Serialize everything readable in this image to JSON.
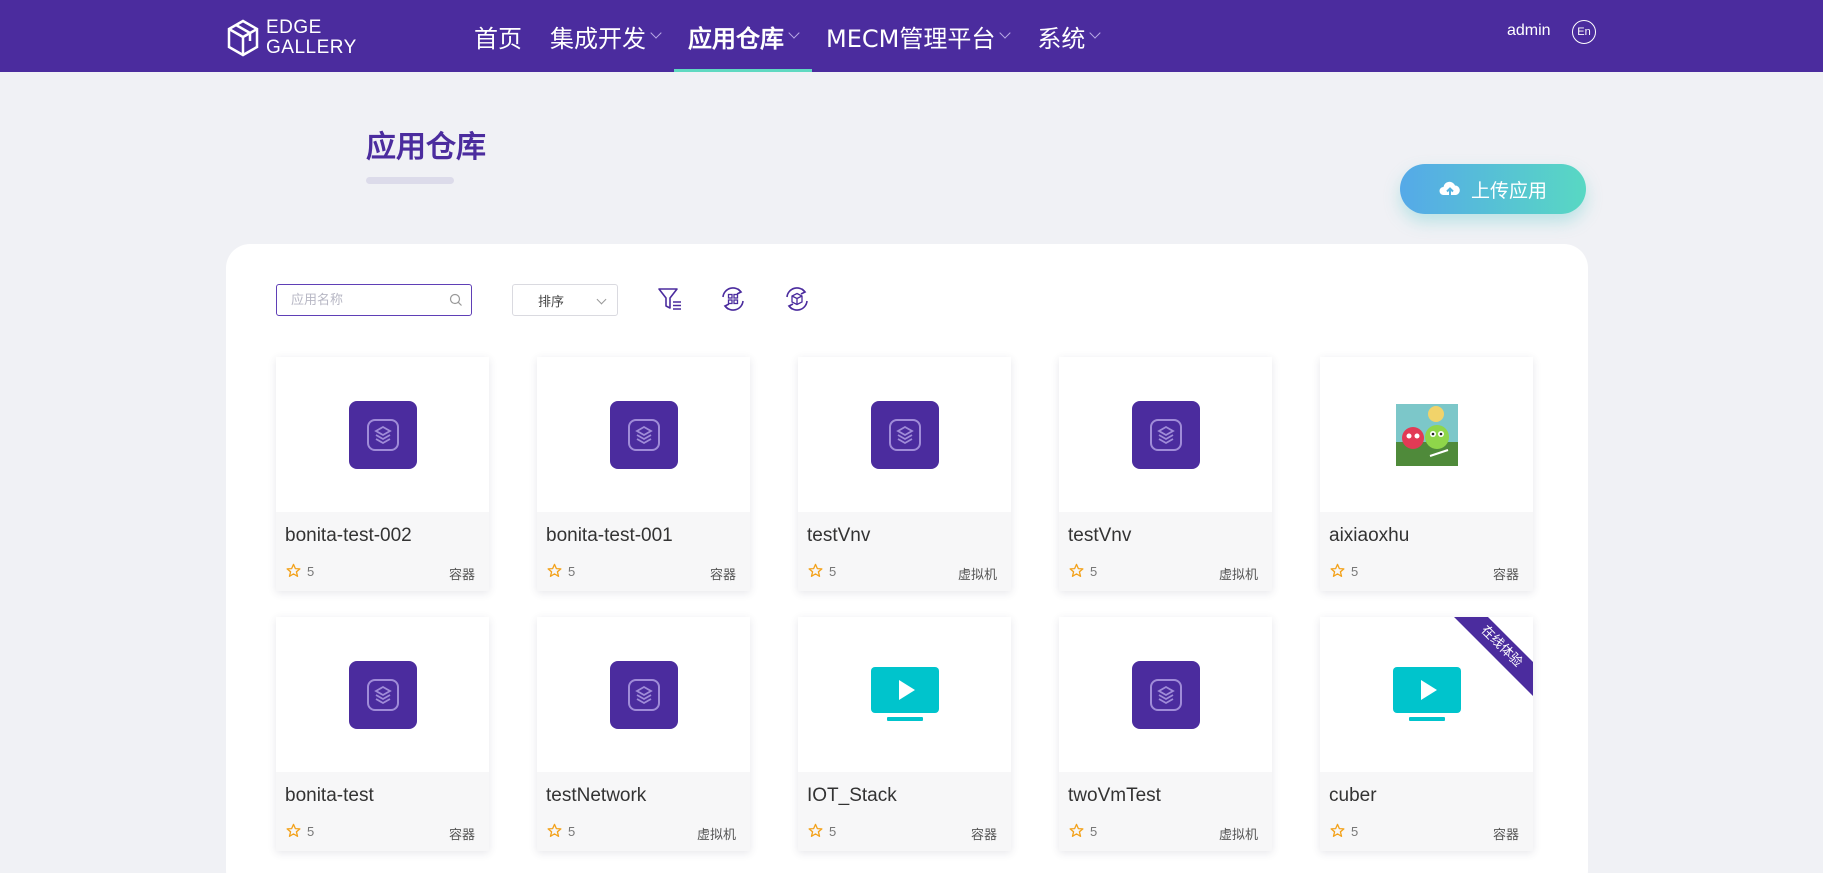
{
  "topbar": {
    "logo_line1": "EDGE",
    "logo_line2": "GALLERY",
    "nav": [
      {
        "label": "首页"
      },
      {
        "label": "集成开发"
      },
      {
        "label": "应用仓库"
      },
      {
        "label": "MECM管理平台"
      },
      {
        "label": "系统"
      }
    ],
    "user": "admin",
    "lang": "En"
  },
  "header": {
    "title": "应用仓库",
    "upload_label": "上传应用"
  },
  "toolbar": {
    "search_placeholder": "应用名称",
    "sort_label": "排序"
  },
  "apps": [
    {
      "name": "bonita-test-002",
      "score": "5",
      "type": "容器",
      "icon": "layers-icon"
    },
    {
      "name": "bonita-test-001",
      "score": "5",
      "type": "容器",
      "icon": "layers-icon"
    },
    {
      "name": "testVnv",
      "score": "5",
      "type": "虚拟机",
      "icon": "layers-icon"
    },
    {
      "name": "testVnv",
      "score": "5",
      "type": "虚拟机",
      "icon": "layers-icon"
    },
    {
      "name": "aixiaoxhu",
      "score": "5",
      "type": "容器",
      "icon": "game-thumbnail"
    },
    {
      "name": "bonita-test",
      "score": "5",
      "type": "容器",
      "icon": "layers-icon"
    },
    {
      "name": "testNetwork",
      "score": "5",
      "type": "虚拟机",
      "icon": "layers-icon"
    },
    {
      "name": "IOT_Stack",
      "score": "5",
      "type": "容器",
      "icon": "video-play-icon"
    },
    {
      "name": "twoVmTest",
      "score": "5",
      "type": "虚拟机",
      "icon": "layers-icon"
    },
    {
      "name": "cuber",
      "score": "5",
      "type": "容器",
      "icon": "video-play-icon",
      "ribbon": "在线体验"
    }
  ],
  "colors": {
    "brand": "#4b2c9e",
    "accent": "#5fd9c1",
    "video_icon": "#00c4cc"
  }
}
